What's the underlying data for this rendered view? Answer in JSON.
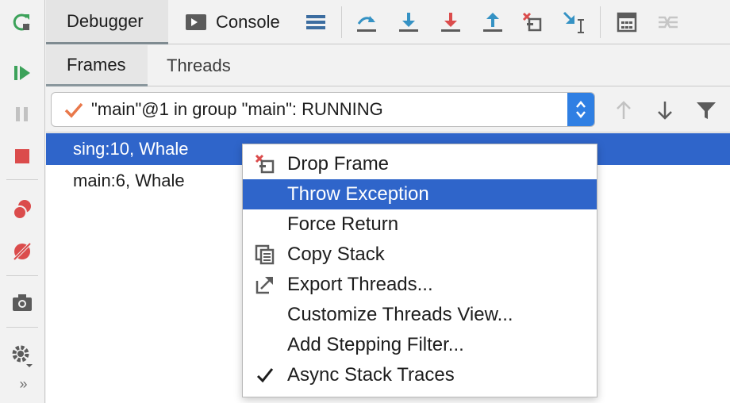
{
  "toolbar": {
    "tabs": [
      {
        "label": "Debugger"
      },
      {
        "label": "Console"
      }
    ],
    "actions": [
      "restore-layout",
      "step-over",
      "step-into",
      "force-step-into",
      "step-out",
      "drop-frame",
      "run-to-cursor",
      "evaluate-expression",
      "trace-current-stream-chain"
    ]
  },
  "left_toolbar": {
    "buttons": [
      "rerun",
      "resume",
      "pause",
      "stop",
      "view-breakpoints",
      "mute-breakpoints",
      "get-thread-dump",
      "settings",
      "more"
    ],
    "more_label": "»"
  },
  "frames_panel": {
    "subtabs": [
      {
        "label": "Frames"
      },
      {
        "label": "Threads"
      }
    ],
    "thread_selector": {
      "value": "\"main\"@1 in group \"main\": RUNNING",
      "status_icon": "check-icon"
    },
    "frames": [
      {
        "label": "sing:10, Whale",
        "selected": true
      },
      {
        "label": "main:6, Whale",
        "selected": false
      }
    ]
  },
  "context_menu": {
    "items": [
      {
        "label": "Drop Frame",
        "icon": "drop-frame-icon",
        "highlighted": false
      },
      {
        "label": "Throw Exception",
        "icon": "",
        "highlighted": true
      },
      {
        "label": "Force Return",
        "icon": "",
        "highlighted": false
      },
      {
        "label": "Copy Stack",
        "icon": "copy-icon",
        "highlighted": false
      },
      {
        "label": "Export Threads...",
        "icon": "export-icon",
        "highlighted": false
      },
      {
        "label": "Customize Threads View...",
        "icon": "",
        "highlighted": false
      },
      {
        "label": "Add Stepping Filter...",
        "icon": "",
        "highlighted": false
      },
      {
        "label": "Async Stack Traces",
        "icon": "checkmark-icon",
        "highlighted": false
      }
    ]
  },
  "colors": {
    "accent": "#2f65ca",
    "combo_arrow": "#2f7fe3",
    "green": "#3ca25a",
    "red": "#db4c4c",
    "step_blue": "#3592c4"
  }
}
